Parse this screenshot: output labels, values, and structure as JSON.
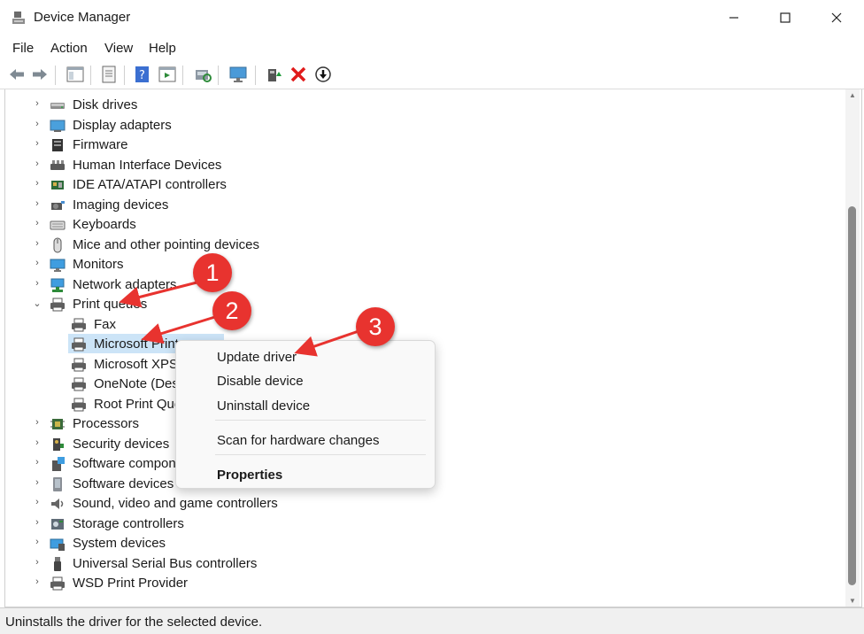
{
  "window": {
    "title": "Device Manager",
    "minimize_icon": "minimize-icon",
    "maximize_icon": "maximize-icon",
    "close_icon": "close-icon"
  },
  "menu": [
    "File",
    "Action",
    "View",
    "Help"
  ],
  "toolbar_icons": [
    "back-arrow-icon",
    "forward-arrow-icon",
    "show-hide-console-tree-icon",
    "properties-icon",
    "help-icon",
    "action-pane-icon",
    "scan-hardware-icon",
    "monitor-icon",
    "update-driver-icon",
    "uninstall-x-icon",
    "disable-device-icon"
  ],
  "tree": [
    {
      "label": "Disk drives",
      "expander": "collapsed",
      "icon": "disk-drive-icon",
      "level": 0
    },
    {
      "label": "Display adapters",
      "expander": "collapsed",
      "icon": "display-adapter-icon",
      "level": 0
    },
    {
      "label": "Firmware",
      "expander": "collapsed",
      "icon": "firmware-icon",
      "level": 0
    },
    {
      "label": "Human Interface Devices",
      "expander": "collapsed",
      "icon": "hid-icon",
      "level": 0
    },
    {
      "label": "IDE ATA/ATAPI controllers",
      "expander": "collapsed",
      "icon": "ide-controller-icon",
      "level": 0
    },
    {
      "label": "Imaging devices",
      "expander": "collapsed",
      "icon": "camera-icon",
      "level": 0
    },
    {
      "label": "Keyboards",
      "expander": "collapsed",
      "icon": "keyboard-icon",
      "level": 0
    },
    {
      "label": "Mice and other pointing devices",
      "expander": "collapsed",
      "icon": "mouse-icon",
      "level": 0
    },
    {
      "label": "Monitors",
      "expander": "collapsed",
      "icon": "monitor-icon",
      "level": 0
    },
    {
      "label": "Network adapters",
      "expander": "collapsed",
      "icon": "network-adapter-icon",
      "level": 0
    },
    {
      "label": "Print queues",
      "expander": "expanded",
      "icon": "printer-icon",
      "level": 0
    },
    {
      "label": "Fax",
      "expander": "none",
      "icon": "printer-icon",
      "level": 1
    },
    {
      "label": "Microsoft Print",
      "expander": "none",
      "icon": "printer-icon",
      "level": 1
    },
    {
      "label": "Microsoft XPS",
      "expander": "none",
      "icon": "printer-icon",
      "level": 1
    },
    {
      "label": "OneNote (Des",
      "expander": "none",
      "icon": "printer-icon",
      "level": 1
    },
    {
      "label": "Root Print Que",
      "expander": "none",
      "icon": "printer-icon",
      "level": 1
    },
    {
      "label": "Processors",
      "expander": "collapsed",
      "icon": "processor-icon",
      "level": 0
    },
    {
      "label": "Security devices",
      "expander": "collapsed",
      "icon": "security-key-icon",
      "level": 0
    },
    {
      "label": "Software compone",
      "expander": "collapsed",
      "icon": "software-component-icon",
      "level": 0
    },
    {
      "label": "Software devices",
      "expander": "collapsed",
      "icon": "software-device-icon",
      "level": 0
    },
    {
      "label": "Sound, video and game controllers",
      "expander": "collapsed",
      "icon": "speaker-icon",
      "level": 0
    },
    {
      "label": "Storage controllers",
      "expander": "collapsed",
      "icon": "storage-controller-icon",
      "level": 0
    },
    {
      "label": "System devices",
      "expander": "collapsed",
      "icon": "system-device-icon",
      "level": 0
    },
    {
      "label": "Universal Serial Bus controllers",
      "expander": "collapsed",
      "icon": "usb-icon",
      "level": 0
    },
    {
      "label": "WSD Print Provider",
      "expander": "collapsed",
      "icon": "printer-icon",
      "level": 0
    }
  ],
  "selected_index": 12,
  "context_menu": {
    "update_driver": "Update driver",
    "disable_device": "Disable device",
    "uninstall_device": "Uninstall device",
    "scan_hardware": "Scan for hardware changes",
    "properties": "Properties"
  },
  "status": "Uninstalls the driver for the selected device.",
  "annotations": {
    "callout_1": "1",
    "callout_2": "2",
    "callout_3": "3",
    "color": "#e8332f"
  }
}
